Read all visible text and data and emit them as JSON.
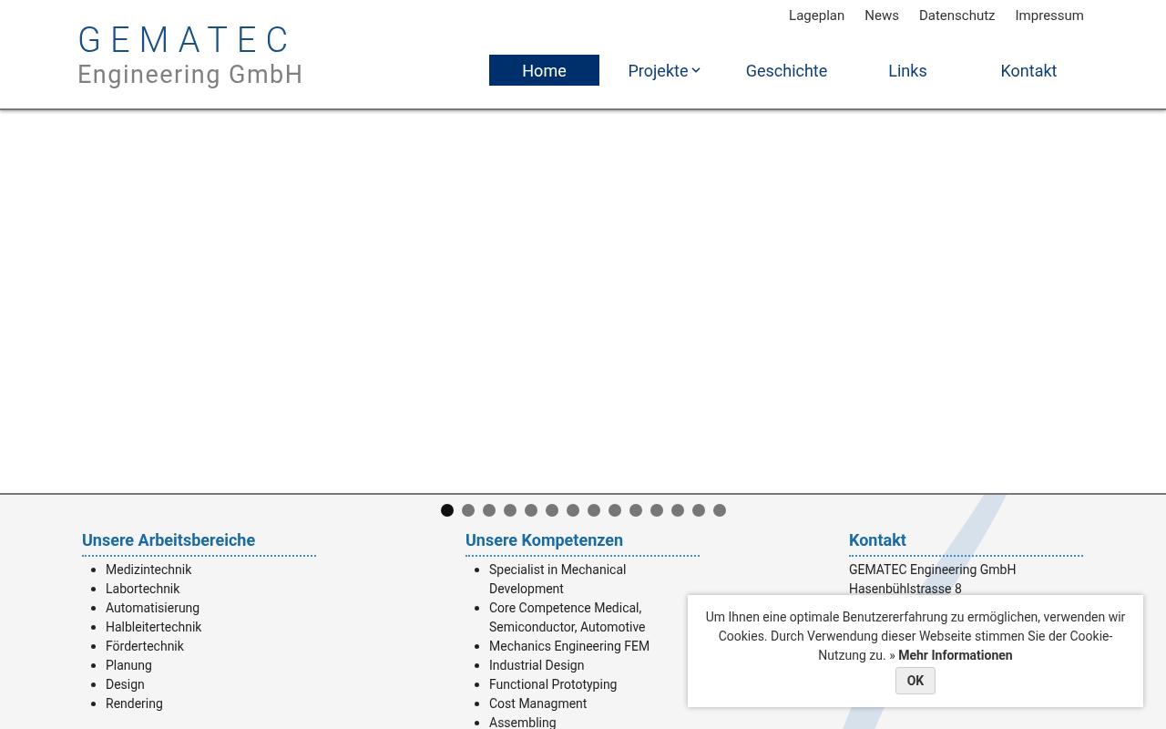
{
  "logo": {
    "wordmark": "GEMATEC",
    "subtitle": "Engineering GmbH"
  },
  "top_links": [
    "Lageplan",
    "News",
    "Datenschutz",
    "Impressum"
  ],
  "nav": [
    {
      "label": "Home",
      "selected": true,
      "dropdown": false
    },
    {
      "label": "Projekte",
      "selected": false,
      "dropdown": true
    },
    {
      "label": "Geschichte",
      "selected": false,
      "dropdown": false
    },
    {
      "label": "Links",
      "selected": false,
      "dropdown": false
    },
    {
      "label": "Kontakt",
      "selected": false,
      "dropdown": false
    }
  ],
  "slider_dots": [
    {
      "selected": true
    },
    {
      "selected": false
    },
    {
      "selected": false
    },
    {
      "selected": false
    },
    {
      "selected": false
    },
    {
      "selected": false
    },
    {
      "selected": false
    },
    {
      "selected": false
    },
    {
      "selected": false
    },
    {
      "selected": false
    },
    {
      "selected": false
    },
    {
      "selected": false
    },
    {
      "selected": false
    },
    {
      "selected": false
    }
  ],
  "columns": [
    {
      "title": "Unsere Arbeitsbereiche",
      "kind": "list",
      "items": [
        "Medizintechnik",
        "Labortechnik",
        "Automatisierung",
        "Halbleitertechnik",
        "Fördertechnik",
        "Planung",
        "Design",
        "Rendering"
      ]
    },
    {
      "title": "Unsere Kompetenzen",
      "kind": "list",
      "items": [
        "Specialist in Mechanical Development",
        "Core Competence Medical, Semiconductor, Automotive",
        "Mechanics Engineering FEM",
        "Industrial Design",
        "Functional Prototyping",
        "Cost Managment",
        "Assembling"
      ]
    },
    {
      "title": "Kontakt",
      "kind": "lines",
      "items": [
        "GEMATEC Engineering GmbH",
        "Hasenbühlstrasse 8"
      ]
    }
  ],
  "cookie": {
    "text": "Um Ihnen eine optimale Benutzererfahrung zu ermöglichen, verwenden wir Cookies. Durch Verwendung dieser Webseite stimmen Sie der Cookie-Nutzung zu. »",
    "link": "Mehr Informationen",
    "button": "OK"
  }
}
